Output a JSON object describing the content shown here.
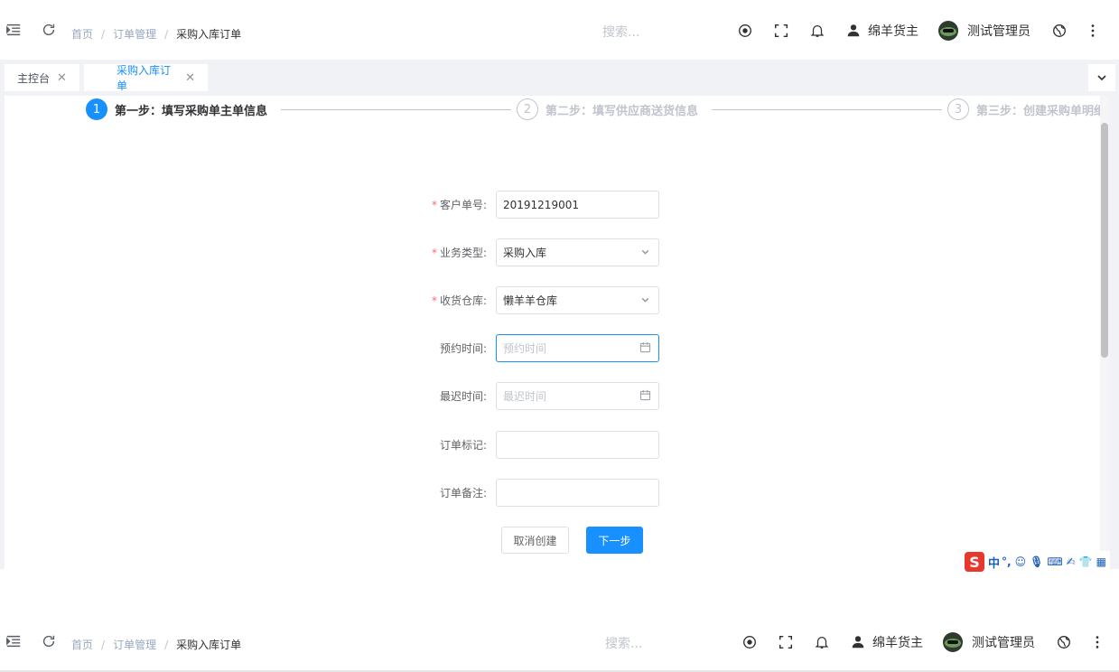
{
  "navbar": {
    "breadcrumb": [
      "首页",
      "订单管理",
      "采购入库订单"
    ],
    "breadcrumb_sep": "/",
    "search_placeholder": "搜索...",
    "owner_name": "绵羊货主",
    "admin_name": "测试管理员"
  },
  "tags": [
    {
      "label": "主控台"
    },
    {
      "label": "采购入库订单"
    }
  ],
  "steps": [
    {
      "num": "1",
      "title": "第一步：填写采购单主单信息"
    },
    {
      "num": "2",
      "title": "第二步：填写供应商送货信息"
    },
    {
      "num": "3",
      "title": "第三步：创建采购单明细信息"
    }
  ],
  "form": {
    "customer_no": {
      "label": "客户单号:",
      "value": "20191219001"
    },
    "biz_type": {
      "label": "业务类型:",
      "value": "采购入库"
    },
    "warehouse": {
      "label": "收货仓库:",
      "value": "懒羊羊仓库"
    },
    "appoint_time": {
      "label": "预约时间:",
      "placeholder": "预约时间"
    },
    "latest_time": {
      "label": "最迟时间:",
      "placeholder": "最迟时间"
    },
    "order_mark": {
      "label": "订单标记:",
      "value": ""
    },
    "order_remark": {
      "label": "订单备注:",
      "value": ""
    },
    "required_mark": "*"
  },
  "buttons": {
    "cancel": "取消创建",
    "next": "下一步"
  },
  "ime": {
    "lang": "中"
  },
  "colors": {
    "primary": "#1890ff",
    "required": "#f56c6c"
  }
}
